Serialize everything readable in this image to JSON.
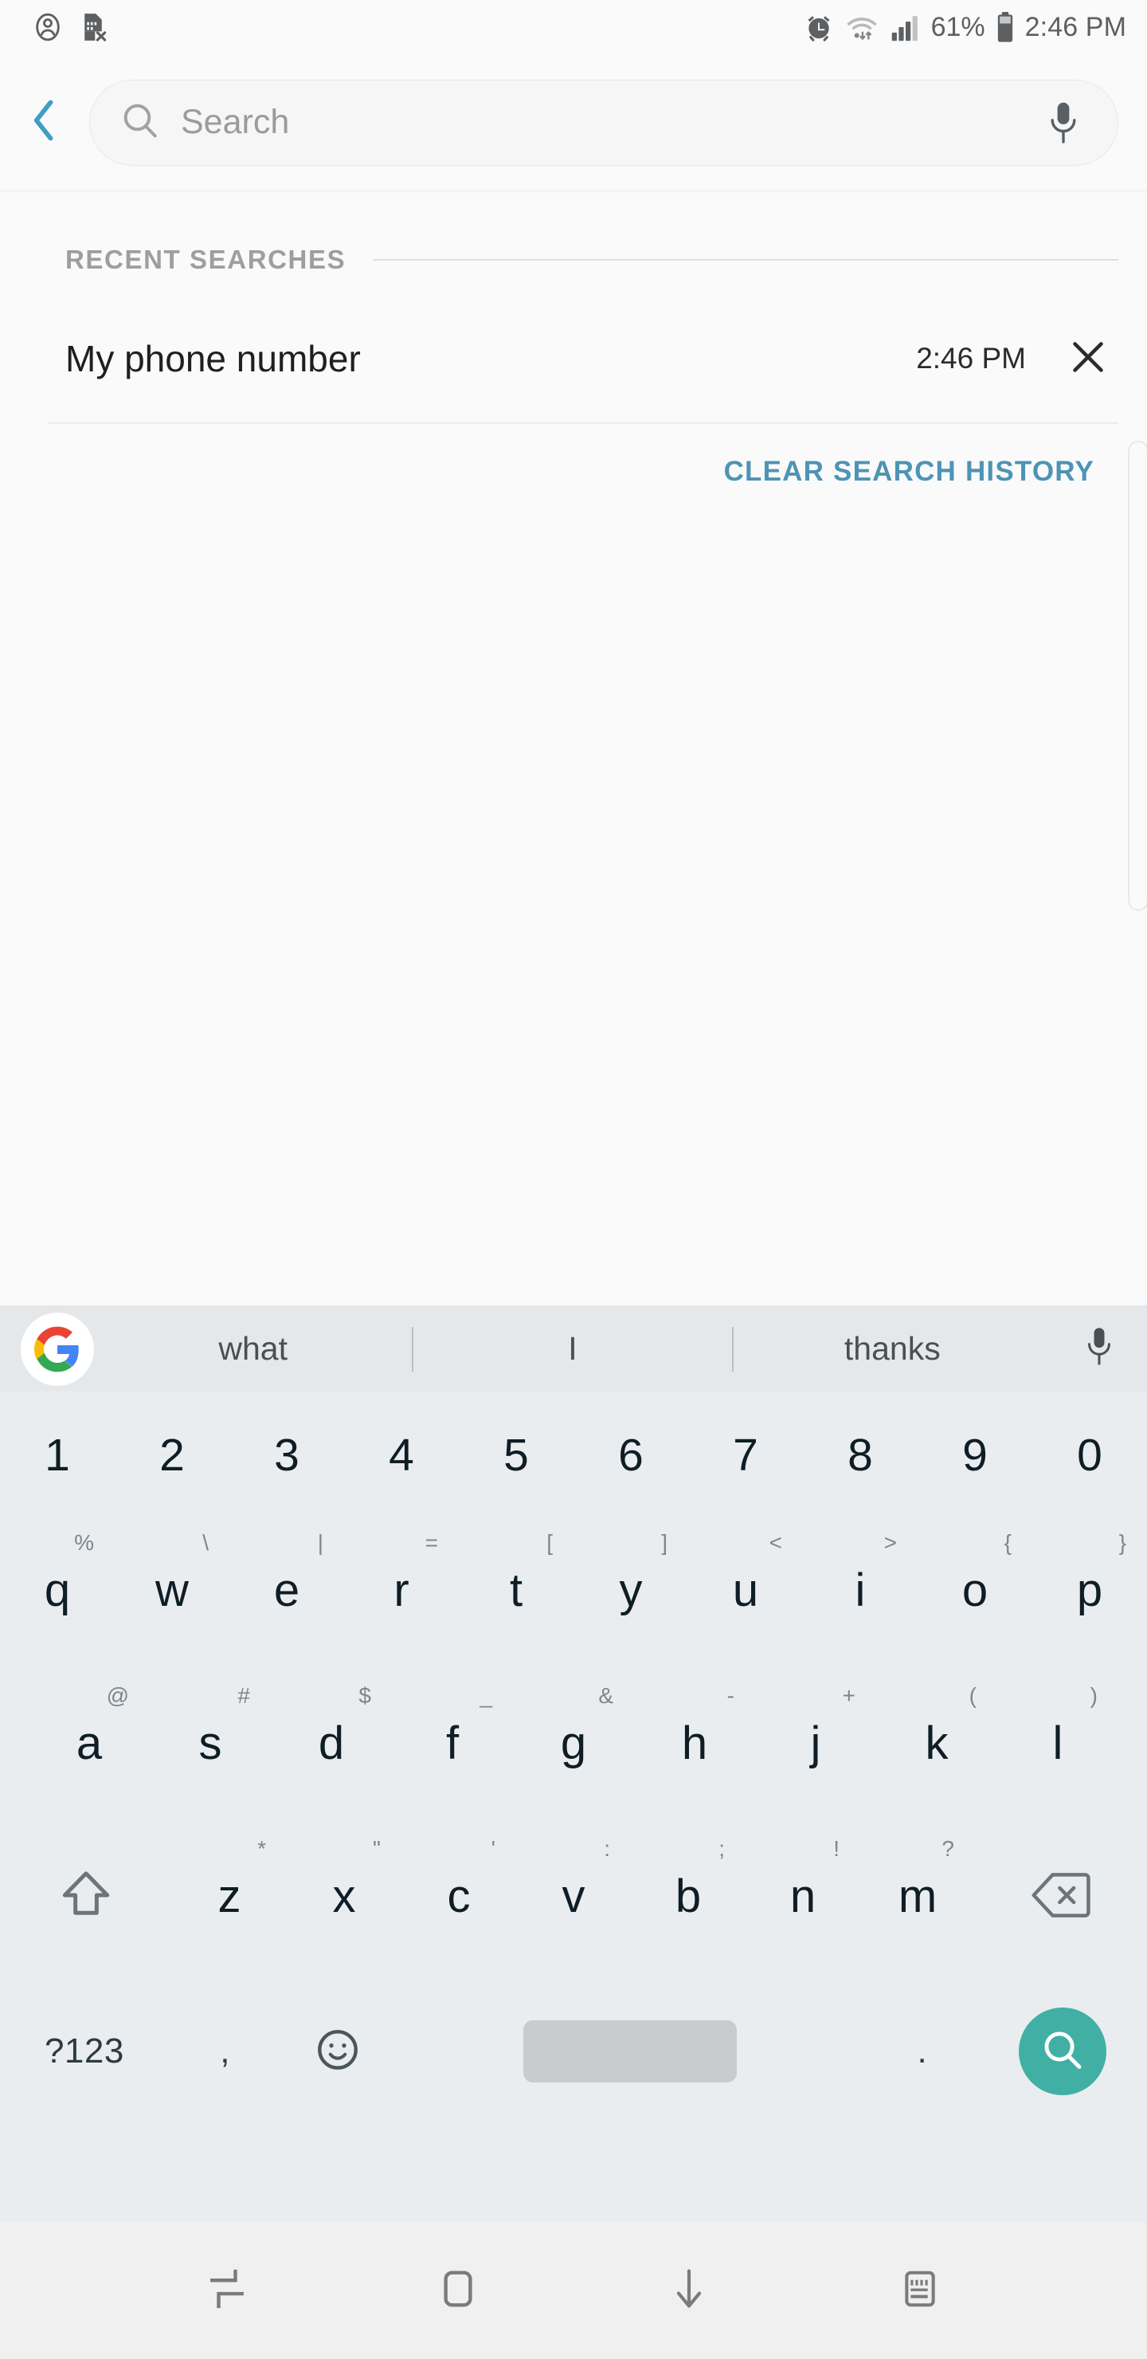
{
  "status_bar": {
    "left_icons": [
      "contact-icon",
      "sim-card-off-icon"
    ],
    "right_icons": [
      "alarm-icon",
      "wifi-icon",
      "signal-icon",
      "battery-icon"
    ],
    "battery_percent": "61%",
    "time": "2:46 PM"
  },
  "header": {
    "back_icon": "chevron-left-icon",
    "search_icon": "search-icon",
    "search_value": "",
    "search_placeholder": "Search",
    "mic_icon": "microphone-icon"
  },
  "content": {
    "section_title": "RECENT SEARCHES",
    "recent_searches": [
      {
        "label": "My phone number",
        "time": "2:46 PM",
        "delete_icon": "close-icon"
      }
    ],
    "clear_label": "CLEAR SEARCH HISTORY"
  },
  "suggestions": {
    "logo": "google-logo-icon",
    "items": [
      "what",
      "I",
      "thanks"
    ],
    "mic_icon": "microphone-icon"
  },
  "keyboard": {
    "number_row": [
      "1",
      "2",
      "3",
      "4",
      "5",
      "6",
      "7",
      "8",
      "9",
      "0"
    ],
    "row1": [
      {
        "key": "q",
        "sup": "%"
      },
      {
        "key": "w",
        "sup": "\\"
      },
      {
        "key": "e",
        "sup": "|"
      },
      {
        "key": "r",
        "sup": "="
      },
      {
        "key": "t",
        "sup": "["
      },
      {
        "key": "y",
        "sup": "]"
      },
      {
        "key": "u",
        "sup": "<"
      },
      {
        "key": "i",
        "sup": ">"
      },
      {
        "key": "o",
        "sup": "{"
      },
      {
        "key": "p",
        "sup": "}"
      }
    ],
    "row2": [
      {
        "key": "a",
        "sup": "@"
      },
      {
        "key": "s",
        "sup": "#"
      },
      {
        "key": "d",
        "sup": "$"
      },
      {
        "key": "f",
        "sup": "_"
      },
      {
        "key": "g",
        "sup": "&"
      },
      {
        "key": "h",
        "sup": "-"
      },
      {
        "key": "j",
        "sup": "+"
      },
      {
        "key": "k",
        "sup": "("
      },
      {
        "key": "l",
        "sup": ")"
      }
    ],
    "row3": [
      {
        "key": "z",
        "sup": "*"
      },
      {
        "key": "x",
        "sup": "\""
      },
      {
        "key": "c",
        "sup": "'"
      },
      {
        "key": "v",
        "sup": ":"
      },
      {
        "key": "b",
        "sup": ";"
      },
      {
        "key": "n",
        "sup": "!"
      },
      {
        "key": "m",
        "sup": "?"
      }
    ],
    "shift_icon": "shift-arrow-icon",
    "backspace_icon": "backspace-icon",
    "symbols_label": "?123",
    "comma_label": ",",
    "emoji_icon": "emoji-smiley-icon",
    "space_label": "",
    "period_label": ".",
    "enter_icon": "search-icon"
  },
  "nav_bar": {
    "recents_icon": "recents-icon",
    "home_icon": "home-icon",
    "hide_keyboard_icon": "arrow-down-icon",
    "keyboard_switch_icon": "keyboard-icon"
  },
  "colors": {
    "accent_teal": "#42afa5",
    "link_blue": "#4d94b5",
    "background": "#fafafa",
    "keyboard_bg": "#eaedef",
    "suggestion_bg": "#e4e8ea"
  }
}
